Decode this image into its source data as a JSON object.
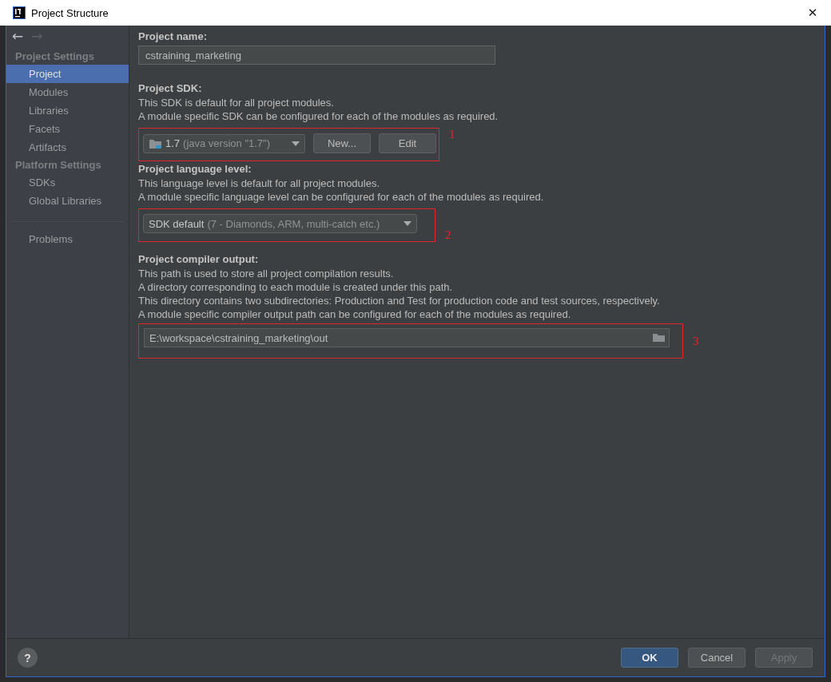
{
  "window": {
    "title": "Project Structure",
    "close": "✕"
  },
  "navigation": {
    "back": "←",
    "forward": "→"
  },
  "sidebar": {
    "sections": [
      {
        "title": "Project Settings",
        "items": [
          {
            "label": "Project",
            "selected": true
          },
          {
            "label": "Modules",
            "selected": false
          },
          {
            "label": "Libraries",
            "selected": false
          },
          {
            "label": "Facets",
            "selected": false
          },
          {
            "label": "Artifacts",
            "selected": false
          }
        ]
      },
      {
        "title": "Platform Settings",
        "items": [
          {
            "label": "SDKs",
            "selected": false
          },
          {
            "label": "Global Libraries",
            "selected": false
          }
        ]
      }
    ],
    "extra_items": [
      {
        "label": "Problems",
        "selected": false
      }
    ]
  },
  "project_name": {
    "label": "Project name:",
    "value": "cstraining_marketing"
  },
  "project_sdk": {
    "label": "Project SDK:",
    "descriptions": [
      "This SDK is default for all project modules.",
      "A module specific SDK can be configured for each of the modules as required."
    ],
    "dropdown": {
      "value": "1.7",
      "detail": "(java version \"1.7\")"
    },
    "buttons": [
      "New...",
      "Edit"
    ],
    "annotation": "1"
  },
  "language_level": {
    "label": "Project language level:",
    "descriptions": [
      "This language level is default for all project modules.",
      "A module specific language level can be configured for each of the modules as required."
    ],
    "dropdown": {
      "value": "SDK default",
      "detail": "(7 - Diamonds, ARM, multi-catch etc.)"
    },
    "annotation": "2"
  },
  "compiler_output": {
    "label": "Project compiler output:",
    "descriptions": [
      "This path is used to store all project compilation results.",
      "A directory corresponding to each module is created under this path.",
      "This directory contains two subdirectories: Production and Test for production code and test sources, respectively.",
      "A module specific compiler output path can be configured for each of the modules as required."
    ],
    "path": "E:\\workspace\\cstraining_marketing\\out",
    "annotation": "3"
  },
  "footer": {
    "help": "?",
    "buttons": [
      {
        "label": "OK",
        "kind": "primary",
        "disabled": false
      },
      {
        "label": "Cancel",
        "kind": "default",
        "disabled": false
      },
      {
        "label": "Apply",
        "kind": "default",
        "disabled": true
      }
    ]
  }
}
